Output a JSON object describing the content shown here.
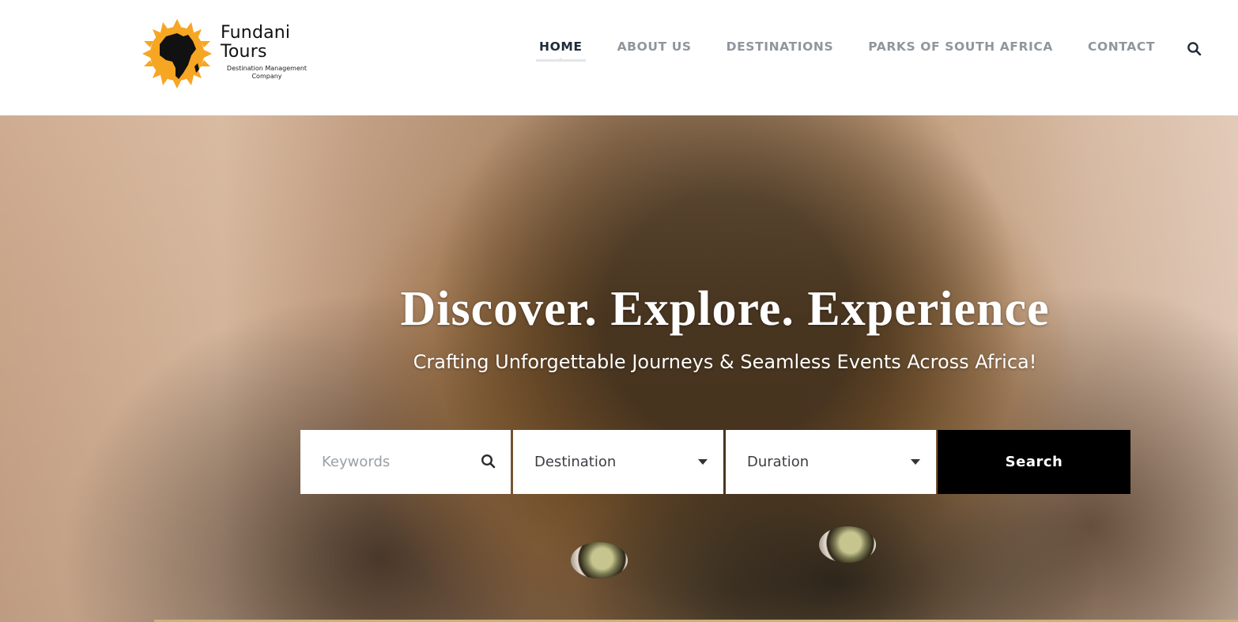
{
  "brand": {
    "name_line1": "Fundani",
    "name_line2": "Tours",
    "tagline": "Destination Management Company",
    "logo_icon": "africa-sun-logo",
    "logo_color": "#f6a623"
  },
  "nav": {
    "items": [
      {
        "label": "HOME",
        "active": true
      },
      {
        "label": "ABOUT US",
        "active": false
      },
      {
        "label": "DESTINATIONS",
        "active": false
      },
      {
        "label": "PARKS OF SOUTH AFRICA",
        "active": false
      },
      {
        "label": "CONTACT",
        "active": false
      }
    ],
    "search_icon": "search-icon",
    "active_color": "#1d2b3a",
    "inactive_color": "#8f969d"
  },
  "hero": {
    "title": "Discover. Explore. Experience",
    "subtitle": "Crafting Unforgettable Journeys & Seamless Events Across Africa!",
    "background": "lion-photo"
  },
  "search": {
    "keywords_placeholder": "Keywords",
    "destination_value": "Destination",
    "duration_value": "Duration",
    "button_label": "Search",
    "button_color": "#000000"
  }
}
